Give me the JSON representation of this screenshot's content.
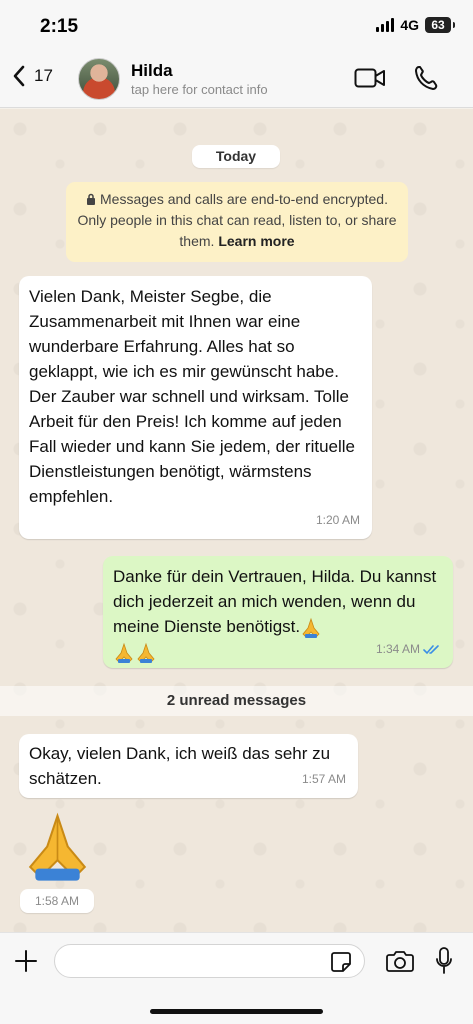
{
  "status_bar": {
    "time": "2:15",
    "network": "4G",
    "battery": "63"
  },
  "header": {
    "back_count": "17",
    "contact_name": "Hilda",
    "contact_subtitle": "tap here for contact info"
  },
  "chat": {
    "date_label": "Today",
    "encryption_notice": "Messages and calls are end-to-end encrypted. Only people in this chat can read, listen to, or share them.",
    "encryption_link": "Learn more",
    "unread_label": "2 unread messages",
    "messages": [
      {
        "direction": "incoming",
        "text": "Vielen Dank, Meister Segbe, die Zusammenarbeit mit Ihnen war eine wunderbare Erfahrung. Alles hat so geklappt, wie ich es mir gewünscht habe. Der Zauber war schnell und wirksam. Tolle Arbeit für den Preis! Ich komme auf jeden Fall wieder und kann Sie jedem, der rituelle Dienstleistungen benötigt, wärmstens empfehlen.",
        "time": "1:20 AM"
      },
      {
        "direction": "outgoing",
        "text": "Danke für dein Vertrauen, Hilda. Du kannst dich jederzeit an mich wenden, wenn du meine Dienste benötigst.",
        "emoji": "folded-hands x3",
        "time": "1:34 AM",
        "status": "read"
      },
      {
        "direction": "incoming",
        "text": "Okay, vielen Dank, ich weiß das sehr zu schätzen.",
        "time": "1:57 AM"
      },
      {
        "direction": "incoming",
        "emoji": "folded-hands",
        "time": "1:58 AM"
      }
    ]
  },
  "composer": {
    "placeholder": ""
  },
  "colors": {
    "incoming_bubble": "#ffffff",
    "outgoing_bubble": "#dcf7c5",
    "encryption_bg": "#fdf1c7",
    "read_ticks": "#3a8ee6"
  }
}
